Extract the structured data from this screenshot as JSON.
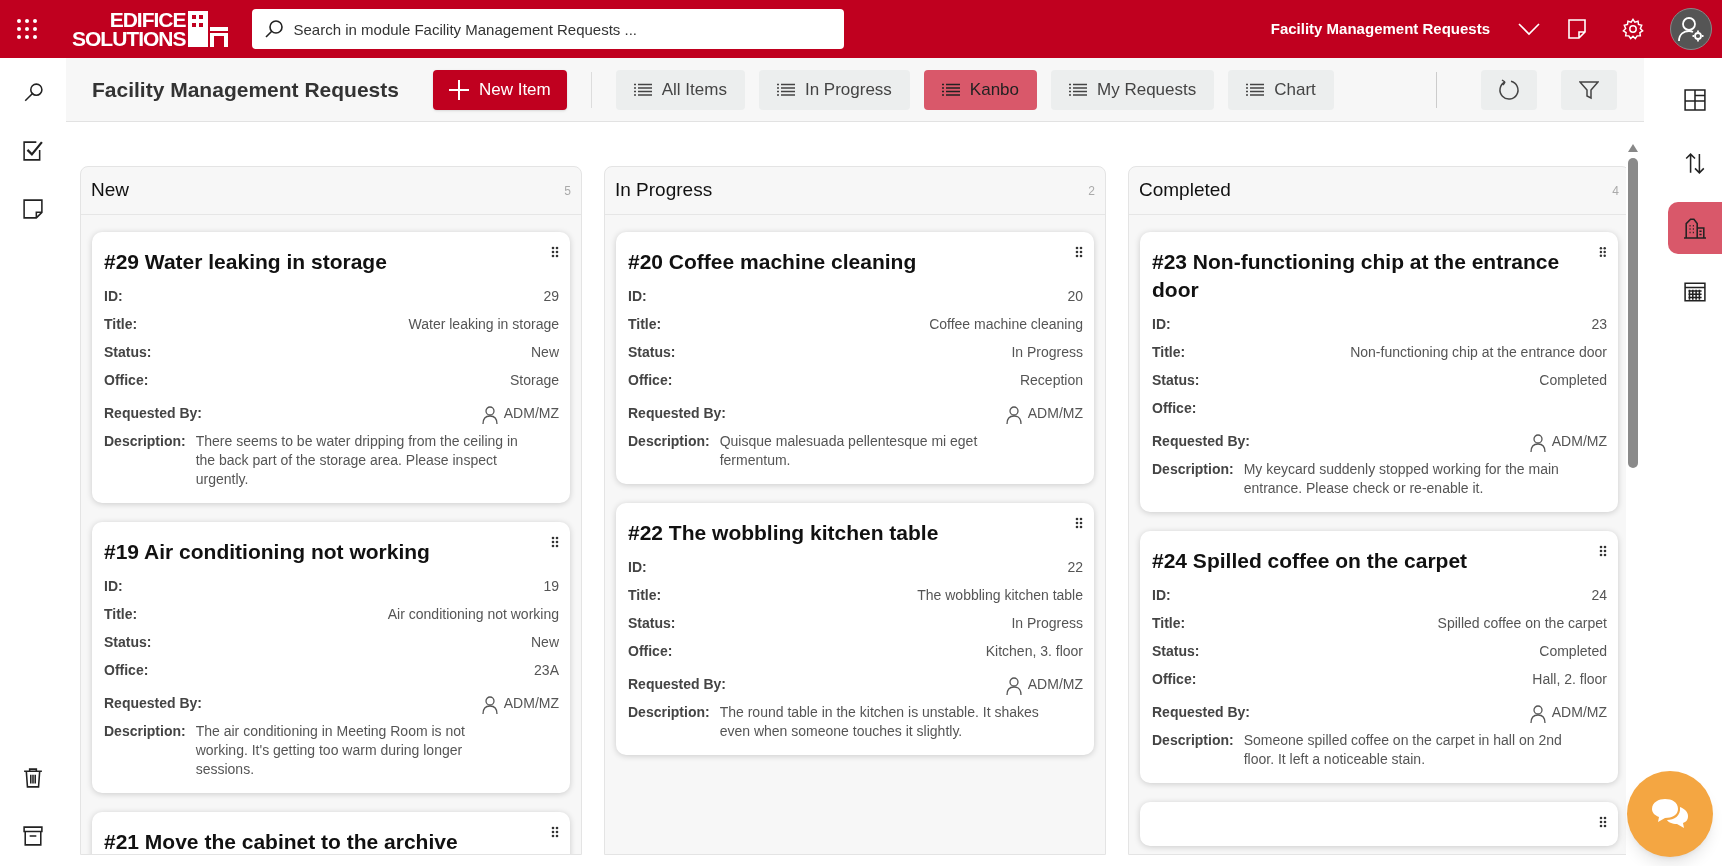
{
  "header": {
    "logo": {
      "line_1": "EDIFICE",
      "line_2": "SOLUTIONS"
    },
    "search": {
      "placeholder": "Search in module Facility Management Requests ..."
    },
    "module_title": "Facility Management Requests"
  },
  "toolbar": {
    "title": "Facility Management Requests",
    "new_button": "New Item",
    "views": [
      {
        "label": "All Items",
        "selected": false
      },
      {
        "label": "In Progress",
        "selected": false
      },
      {
        "label": "Kanbo",
        "selected": true
      },
      {
        "label": "My Requests",
        "selected": false
      },
      {
        "label": "Chart",
        "selected": false
      }
    ]
  },
  "left_rail": [
    {
      "kind": "search"
    },
    {
      "kind": "tasks"
    },
    {
      "kind": "note"
    },
    {
      "kind": "spacer"
    },
    {
      "kind": "trash"
    },
    {
      "kind": "archive"
    }
  ],
  "right_rail": [
    {
      "kind": "layout",
      "selected": false
    },
    {
      "kind": "sort",
      "selected": false
    },
    {
      "kind": "building",
      "selected": true
    },
    {
      "kind": "calendar",
      "selected": false
    }
  ],
  "board": {
    "columns": [
      {
        "title": "New",
        "count": "5",
        "cards": [
          {
            "kind": "full",
            "title": "#29 Water leaking in storage",
            "fields": [
              {
                "kind": "text",
                "label": "ID:",
                "value": "29"
              },
              {
                "kind": "text",
                "label": "Title:",
                "value": "Water leaking in storage"
              },
              {
                "kind": "text",
                "label": "Status:",
                "value": "New"
              },
              {
                "kind": "text",
                "label": "Office:",
                "value": "Storage"
              },
              {
                "kind": "person",
                "label": "Requested By:",
                "value": "ADM/MZ"
              },
              {
                "kind": "description",
                "label": "Description:",
                "value": "There seems to be water dripping from the ceiling in the back part of the storage area. Please inspect urgently."
              }
            ]
          },
          {
            "kind": "full",
            "title": "#19 Air conditioning not working",
            "fields": [
              {
                "kind": "text",
                "label": "ID:",
                "value": "19"
              },
              {
                "kind": "text",
                "label": "Title:",
                "value": "Air conditioning not working"
              },
              {
                "kind": "text",
                "label": "Status:",
                "value": "New"
              },
              {
                "kind": "text",
                "label": "Office:",
                "value": "23A"
              },
              {
                "kind": "person",
                "label": "Requested By:",
                "value": "ADM/MZ"
              },
              {
                "kind": "description",
                "label": "Description:",
                "value": "The air conditioning in Meeting Room is not working. It's getting too warm during longer sessions."
              }
            ]
          },
          {
            "kind": "cut",
            "title": "#21 Move the cabinet to the archive"
          }
        ]
      },
      {
        "title": "In Progress",
        "count": "2",
        "cards": [
          {
            "kind": "full",
            "title": "#20 Coffee machine cleaning",
            "fields": [
              {
                "kind": "text",
                "label": "ID:",
                "value": "20"
              },
              {
                "kind": "text",
                "label": "Title:",
                "value": "Coffee machine cleaning"
              },
              {
                "kind": "text",
                "label": "Status:",
                "value": "In Progress"
              },
              {
                "kind": "text",
                "label": "Office:",
                "value": "Reception"
              },
              {
                "kind": "person",
                "label": "Requested By:",
                "value": "ADM/MZ"
              },
              {
                "kind": "description",
                "label": "Description:",
                "value": "Quisque malesuada pellentesque mi eget fermentum."
              }
            ]
          },
          {
            "kind": "full",
            "title": "#22 The wobbling kitchen table",
            "fields": [
              {
                "kind": "text",
                "label": "ID:",
                "value": "22"
              },
              {
                "kind": "text",
                "label": "Title:",
                "value": "The wobbling kitchen table"
              },
              {
                "kind": "text",
                "label": "Status:",
                "value": "In Progress"
              },
              {
                "kind": "text",
                "label": "Office:",
                "value": "Kitchen, 3. floor"
              },
              {
                "kind": "person",
                "label": "Requested By:",
                "value": "ADM/MZ"
              },
              {
                "kind": "description",
                "label": "Description:",
                "value": "The round table in the kitchen is unstable. It shakes even when someone touches it slightly."
              }
            ]
          }
        ]
      },
      {
        "title": "Completed",
        "count": "4",
        "cards": [
          {
            "kind": "full",
            "title": "#23 Non-functioning chip at the entrance door",
            "fields": [
              {
                "kind": "text",
                "label": "ID:",
                "value": "23"
              },
              {
                "kind": "text",
                "label": "Title:",
                "value": "Non-functioning chip at the entrance door"
              },
              {
                "kind": "text",
                "label": "Status:",
                "value": "Completed"
              },
              {
                "kind": "text",
                "label": "Office:"
              },
              {
                "kind": "person",
                "label": "Requested By:",
                "value": "ADM/MZ"
              },
              {
                "kind": "description",
                "label": "Description:",
                "value": "My keycard suddenly stopped working for the main entrance. Please check or re-enable it."
              }
            ]
          },
          {
            "kind": "full",
            "title": "#24 Spilled coffee on the carpet",
            "fields": [
              {
                "kind": "text",
                "label": "ID:",
                "value": "24"
              },
              {
                "kind": "text",
                "label": "Title:",
                "value": "Spilled coffee on the carpet"
              },
              {
                "kind": "text",
                "label": "Status:",
                "value": "Completed"
              },
              {
                "kind": "text",
                "label": "Office:",
                "value": "Hall, 2. floor"
              },
              {
                "kind": "person",
                "label": "Requested By:",
                "value": "ADM/MZ"
              },
              {
                "kind": "description",
                "label": "Description:",
                "value": "Someone spilled coffee on the carpet in hall on 2nd floor. It left a noticeable stain."
              }
            ]
          },
          {
            "kind": "cut"
          }
        ]
      }
    ]
  }
}
